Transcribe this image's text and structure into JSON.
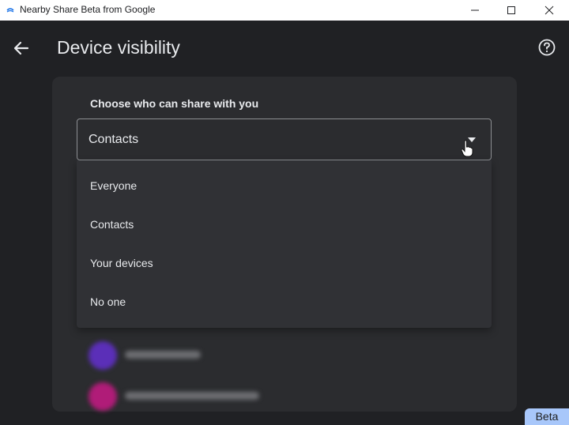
{
  "window": {
    "title": "Nearby Share Beta from Google",
    "icons": [
      "app-icon",
      "minimize-icon",
      "maximize-icon",
      "close-icon"
    ]
  },
  "header": {
    "title": "Device visibility",
    "back_icon": "arrow-left-icon",
    "help_icon": "help-circle-icon"
  },
  "visibility": {
    "label": "Choose who can share with you",
    "selected": "Contacts",
    "caret_icon": "triangle-down-icon",
    "options": [
      "Everyone",
      "Contacts",
      "Your devices",
      "No one"
    ]
  },
  "contacts": [
    {
      "avatar_color": "#5b2fb8"
    },
    {
      "avatar_color": "#b01c78"
    }
  ],
  "badge": "Beta",
  "colors": {
    "background": "#202124",
    "card": "#2b2c2f",
    "dropdown": "#303135",
    "badge": "#a8c7fa"
  }
}
